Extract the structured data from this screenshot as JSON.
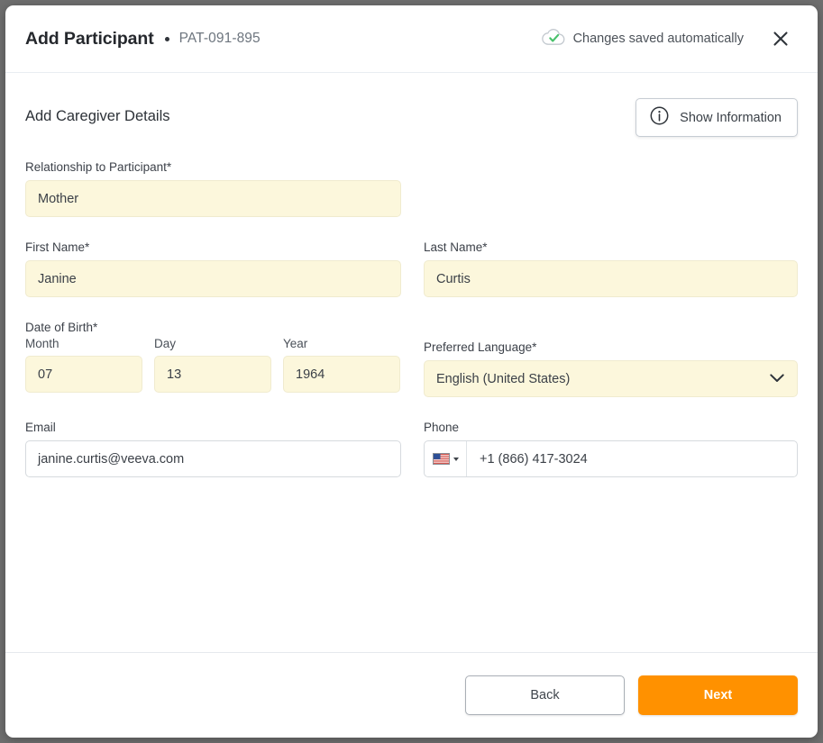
{
  "header": {
    "title": "Add Participant",
    "participant_id": "PAT-091-895",
    "saved_status": "Changes saved automatically",
    "saved_icon": "cloud-check-icon",
    "close_icon": "close-icon"
  },
  "section": {
    "title": "Add Caregiver Details",
    "info_button_label": "Show Information",
    "info_icon": "info-circle-icon"
  },
  "form": {
    "relationship": {
      "label": "Relationship to Participant*",
      "value": "Mother",
      "placeholder": ""
    },
    "first_name": {
      "label": "First Name*",
      "value": "Janine",
      "placeholder": ""
    },
    "last_name": {
      "label": "Last Name*",
      "value": "Curtis",
      "placeholder": ""
    },
    "date_of_birth": {
      "label": "Date of Birth*",
      "month": {
        "label": "Month",
        "value": "07",
        "placeholder": ""
      },
      "day": {
        "label": "Day",
        "value": "13",
        "placeholder": ""
      },
      "year": {
        "label": "Year",
        "value": "1964",
        "placeholder": ""
      }
    },
    "preferred_language": {
      "label": "Preferred Language*",
      "value": "English (United States)",
      "chevron_icon": "chevron-down-icon"
    },
    "email": {
      "label": "Email",
      "value": "janine.curtis@veeva.com",
      "placeholder": ""
    },
    "phone": {
      "label": "Phone",
      "value": "+1 (866) 417-3024",
      "placeholder": "",
      "country_flag": "us-flag-icon",
      "country_caret_icon": "caret-down-icon"
    }
  },
  "footer": {
    "back_label": "Back",
    "next_label": "Next"
  },
  "colors": {
    "accent_orange": "#FF9100",
    "field_filled_bg": "#FCF7DC",
    "saved_check_green": "#49C16B",
    "page_backdrop": "#6E6E6E"
  }
}
